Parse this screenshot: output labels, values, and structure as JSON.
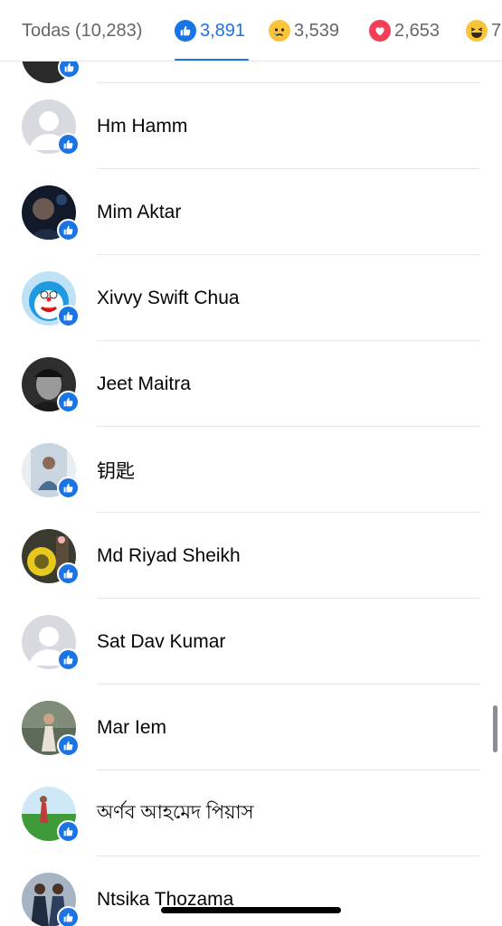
{
  "tabs": {
    "all_label": "Todas (10,283)",
    "like_count": "3,891",
    "sad_count": "3,539",
    "love_count": "2,653",
    "haha_count": "7",
    "like_color": "#1b74e4"
  },
  "icons": {
    "like": "thumbs-up-icon",
    "sad": "sad-face-icon",
    "love": "heart-icon",
    "haha": "laughing-face-icon"
  },
  "people": [
    {
      "name": "Hm Hamm",
      "avatar": "default"
    },
    {
      "name": "Mim Aktar",
      "avatar": "photo"
    },
    {
      "name": "Xivvy Swift Chua",
      "avatar": "cartoon"
    },
    {
      "name": "Jeet Maitra",
      "avatar": "photo"
    },
    {
      "name": "钥匙",
      "avatar": "photo"
    },
    {
      "name": "Md Riyad Sheikh",
      "avatar": "photo"
    },
    {
      "name": "Sat Dav Kumar",
      "avatar": "default"
    },
    {
      "name": "Mar Iem",
      "avatar": "photo"
    },
    {
      "name": "অর্ণব আহমেদ পিয়াস",
      "avatar": "photo"
    },
    {
      "name": "Ntsika Thozama",
      "avatar": "photo"
    }
  ]
}
